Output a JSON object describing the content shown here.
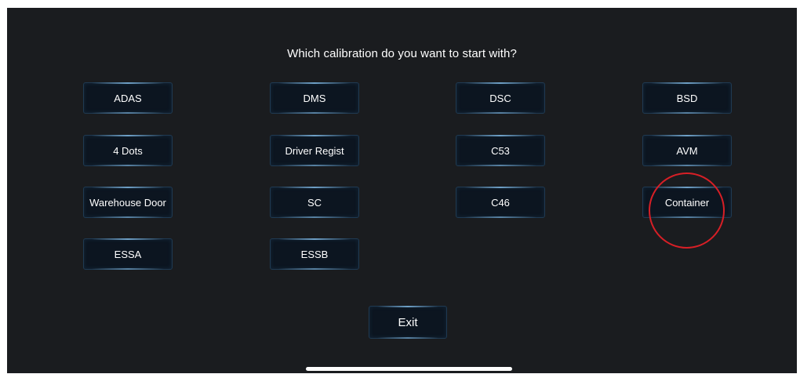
{
  "prompt": {
    "title": "Which calibration do you want to start with?"
  },
  "calibrations": [
    {
      "id": "adas",
      "label": "ADAS"
    },
    {
      "id": "dms",
      "label": "DMS"
    },
    {
      "id": "dsc",
      "label": "DSC"
    },
    {
      "id": "bsd",
      "label": "BSD"
    },
    {
      "id": "4-dots",
      "label": "4 Dots"
    },
    {
      "id": "driver-regist",
      "label": "Driver Regist"
    },
    {
      "id": "c53",
      "label": "C53"
    },
    {
      "id": "avm",
      "label": "AVM"
    },
    {
      "id": "warehouse-door",
      "label": "Warehouse Door"
    },
    {
      "id": "sc",
      "label": "SC"
    },
    {
      "id": "c46",
      "label": "C46"
    },
    {
      "id": "container",
      "label": "Container"
    },
    {
      "id": "essa",
      "label": "ESSA"
    },
    {
      "id": "essb",
      "label": "ESSB"
    }
  ],
  "actions": {
    "exit_label": "Exit"
  },
  "annotation": {
    "highlighted_item": "Container",
    "color": "#d71f26"
  },
  "colors": {
    "background": "#1a1c1f",
    "button_fill": "#0c1520",
    "button_border": "#1f3a52",
    "text": "#ffffff"
  }
}
